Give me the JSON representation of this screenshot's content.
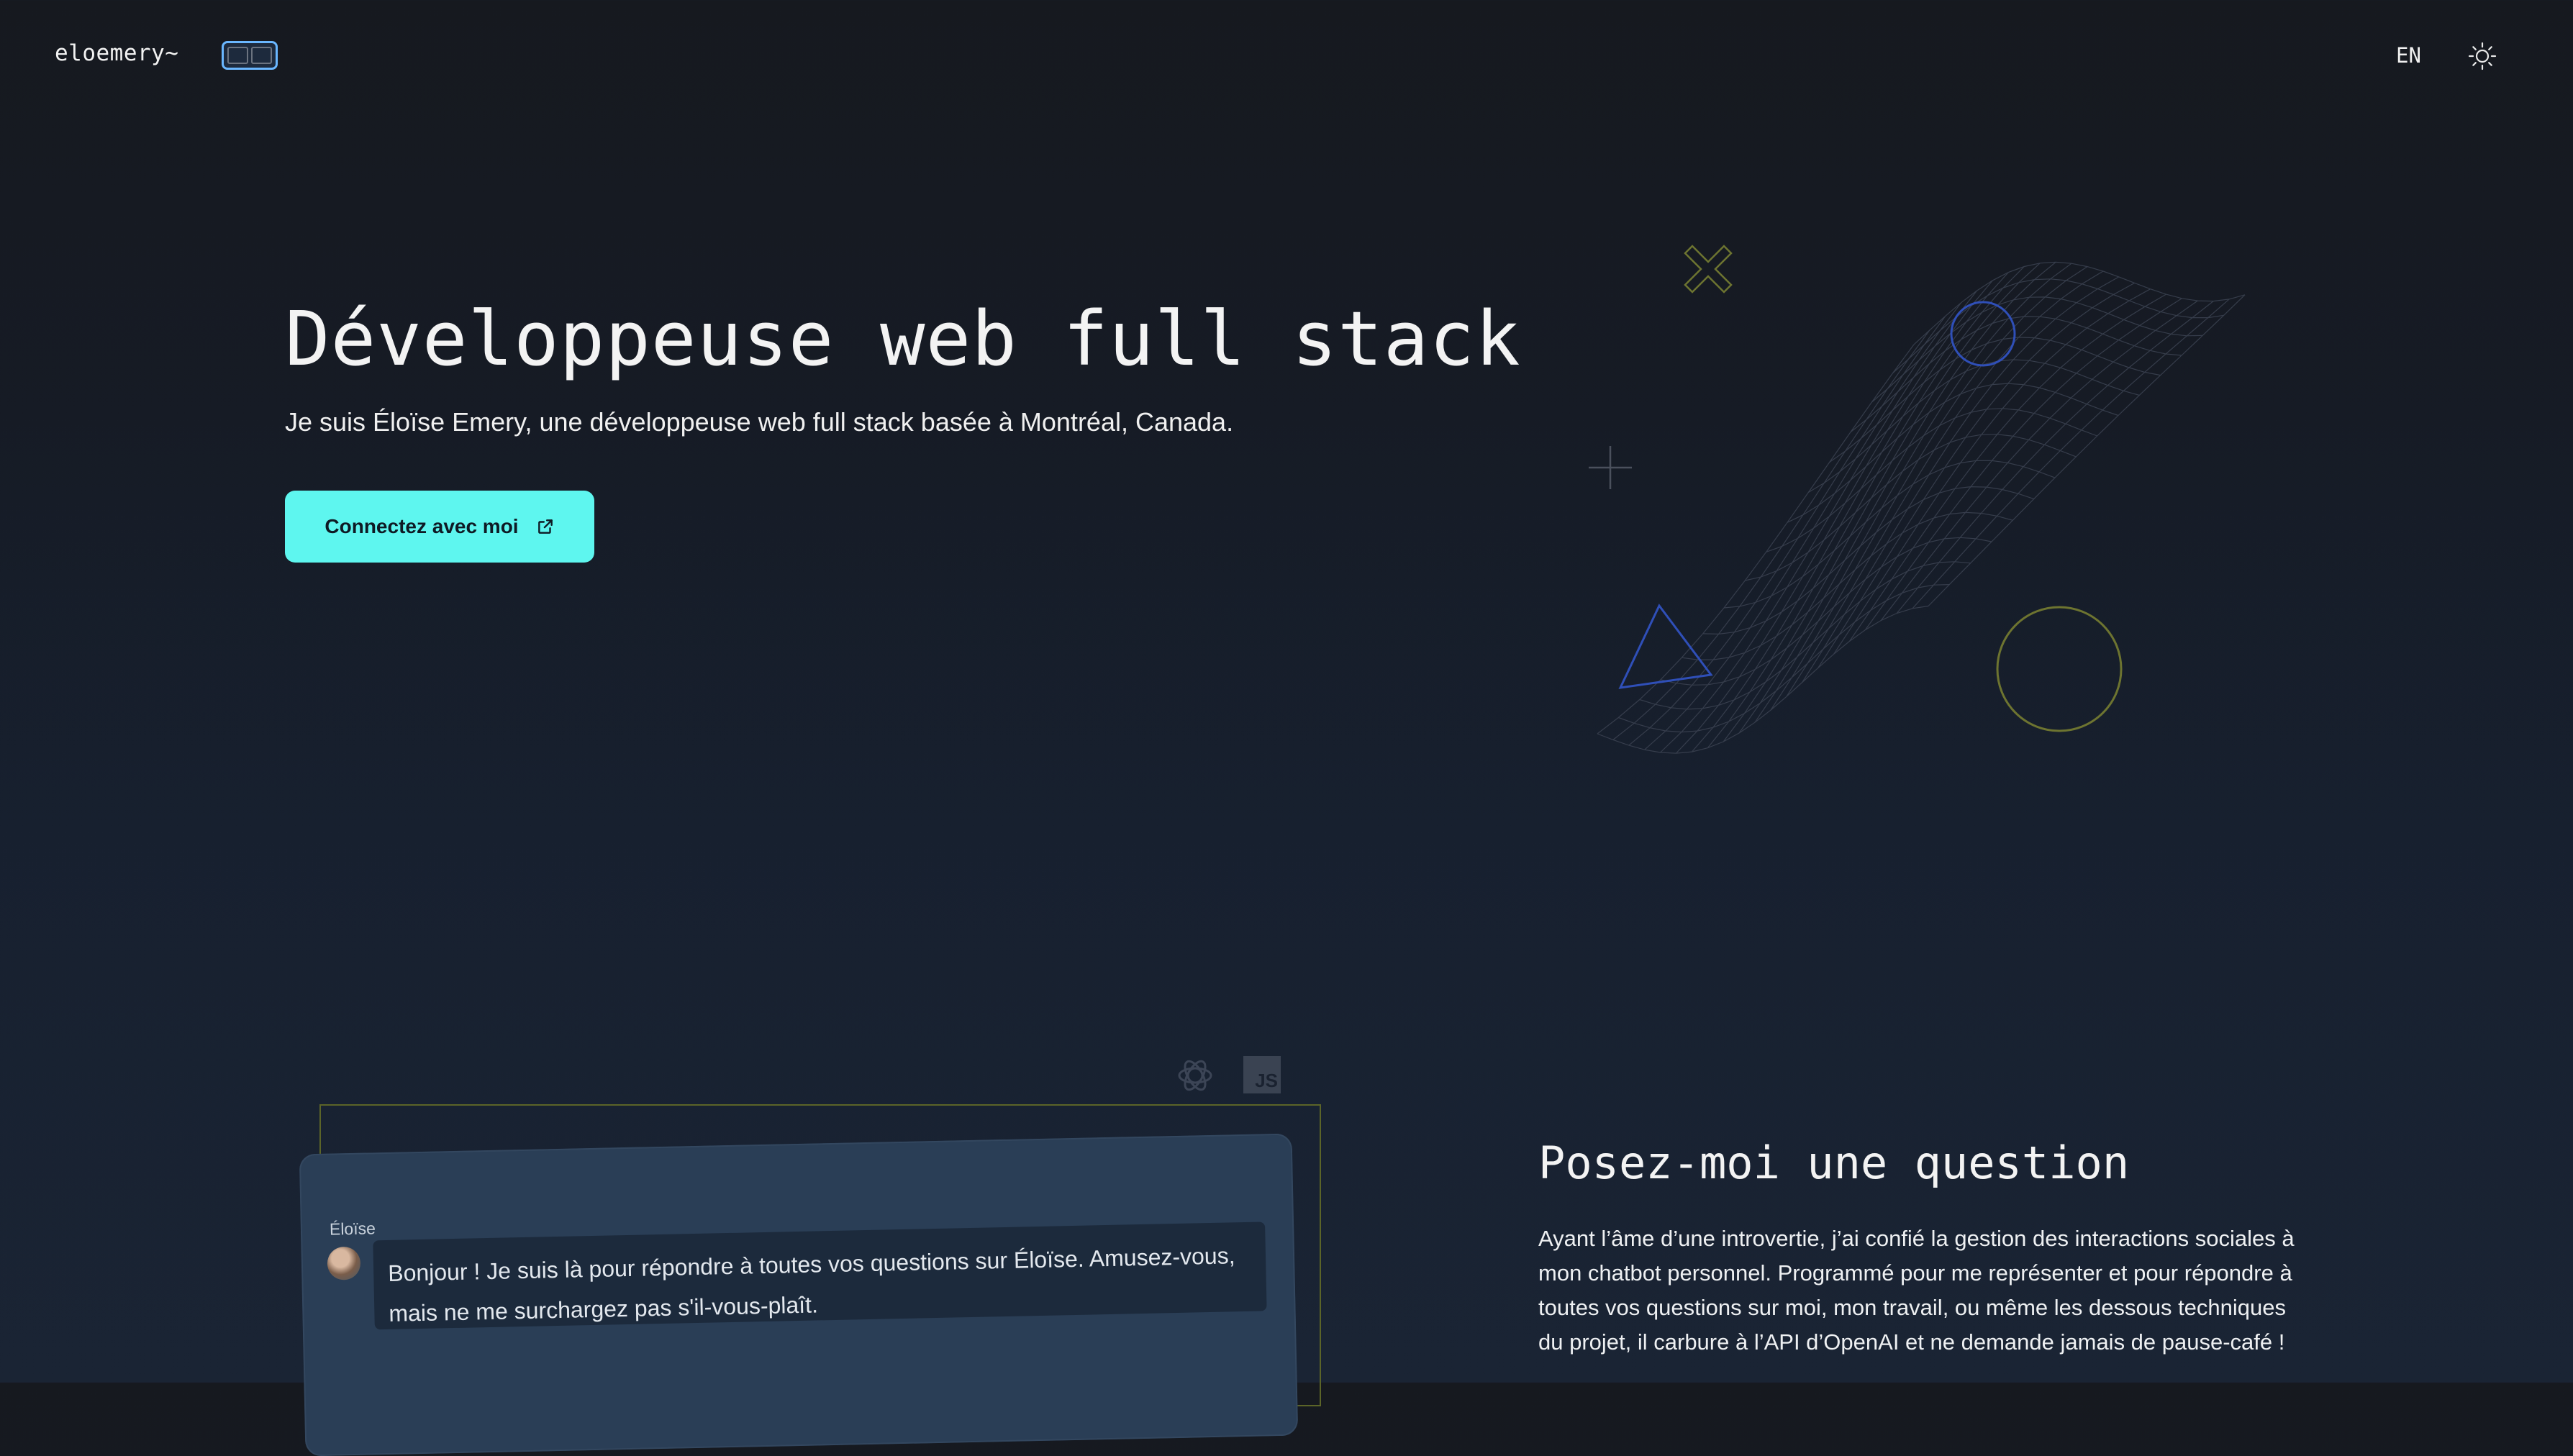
{
  "header": {
    "logo": "eloemery~",
    "lang_label": "EN",
    "layout_toggle_icon": "layout-columns-icon",
    "theme_icon": "sun-icon"
  },
  "hero": {
    "title": "Développeuse web full stack",
    "subtitle": "Je suis Éloïse Emery, une développeuse web full stack basée à Montréal, Canada.",
    "cta_label": "Connectez avec moi",
    "cta_icon": "external-link-icon"
  },
  "chat": {
    "tech_icons": [
      "openai-icon",
      "javascript-icon"
    ],
    "js_label": "JS",
    "sender": "Éloïse",
    "message": "Bonjour ! Je suis là pour répondre à toutes vos questions sur Éloïse. Amusez-vous, mais ne me surchargez pas s'il-vous-plaît."
  },
  "question": {
    "title": "Posez-moi une question",
    "text": "Ayant l’âme d’une introvertie, j’ai confié la gestion des interactions sociales à mon chatbot personnel. Programmé pour me représenter et pour répondre à toutes vos questions sur moi, mon travail, ou même les dessous techniques du projet, il carbure à l’API d’OpenAI et ne demande jamais de pause-café !"
  },
  "colors": {
    "accent": "#5ef6ef",
    "toggle_border": "#6ab7ff",
    "deco_blue": "#2f4fb8",
    "deco_olive": "#6d7430"
  }
}
